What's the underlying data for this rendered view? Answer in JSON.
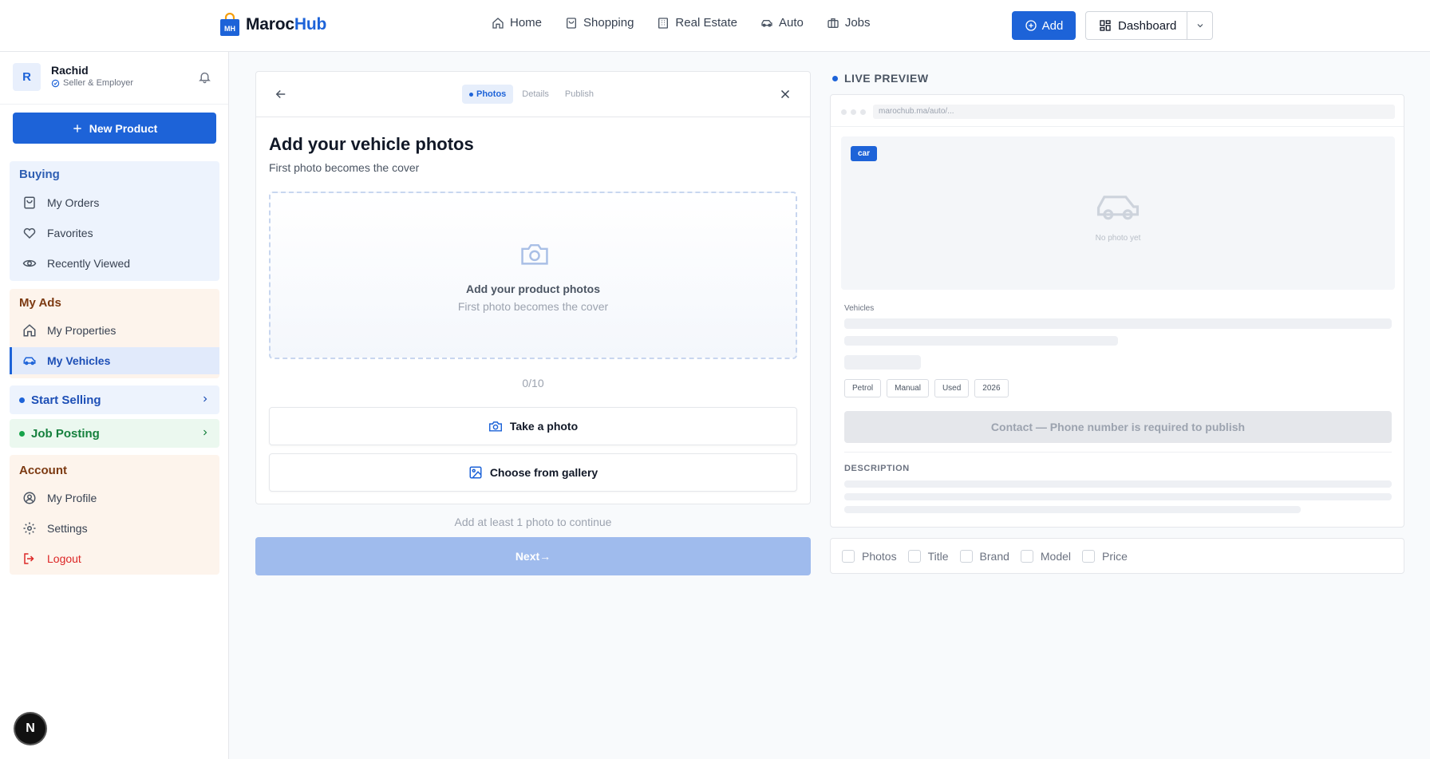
{
  "brand": {
    "logo_mark": "MH",
    "name_part1": "Maroc",
    "name_part2": "Hub"
  },
  "nav": [
    {
      "label": "Home",
      "icon": "home-icon"
    },
    {
      "label": "Shopping",
      "icon": "shopping-bag-icon"
    },
    {
      "label": "Real Estate",
      "icon": "building-icon"
    },
    {
      "label": "Auto",
      "icon": "car-icon"
    },
    {
      "label": "Jobs",
      "icon": "briefcase-icon"
    }
  ],
  "header": {
    "add_label": "Add",
    "dashboard_label": "Dashboard"
  },
  "user": {
    "initial": "R",
    "name": "Rachid",
    "role": "Seller & Employer"
  },
  "sidebar": {
    "new_product": "New Product",
    "buying": {
      "title": "Buying",
      "items": [
        "My Orders",
        "Favorites",
        "Recently Viewed"
      ]
    },
    "my_ads": {
      "title": "My Ads",
      "items": [
        "My Properties",
        "My Vehicles"
      ]
    },
    "start_selling": "Start Selling",
    "job_posting": "Job Posting",
    "account": {
      "title": "Account",
      "items": [
        "My Profile",
        "Settings",
        "Logout"
      ]
    },
    "badge": "N"
  },
  "wizard": {
    "steps": [
      "Photos",
      "Details",
      "Publish"
    ],
    "title": "Add your vehicle photos",
    "subtitle": "First photo becomes the cover",
    "dropzone_title": "Add your product photos",
    "dropzone_sub": "First photo becomes the cover",
    "count": "0/10",
    "take_photo": "Take a photo",
    "gallery": "Choose from gallery",
    "hint": "Add at least 1 photo to continue",
    "next": "Next→"
  },
  "preview": {
    "label": "LIVE PREVIEW",
    "url": "marochub.ma/auto/...",
    "badge": "car",
    "no_photo": "No photo yet",
    "category": "Vehicles",
    "tags": [
      "Petrol",
      "Manual",
      "Used",
      "2026"
    ],
    "contact": "Contact — Phone number is required to publish",
    "description_heading": "DESCRIPTION",
    "checklist": [
      "Photos",
      "Title",
      "Brand",
      "Model",
      "Price"
    ]
  },
  "colors": {
    "primary": "#1d63d8",
    "danger": "#dc2626",
    "success": "#16a34a",
    "buying_bg": "#edf3fd",
    "ads_bg": "#fdf4ec"
  }
}
